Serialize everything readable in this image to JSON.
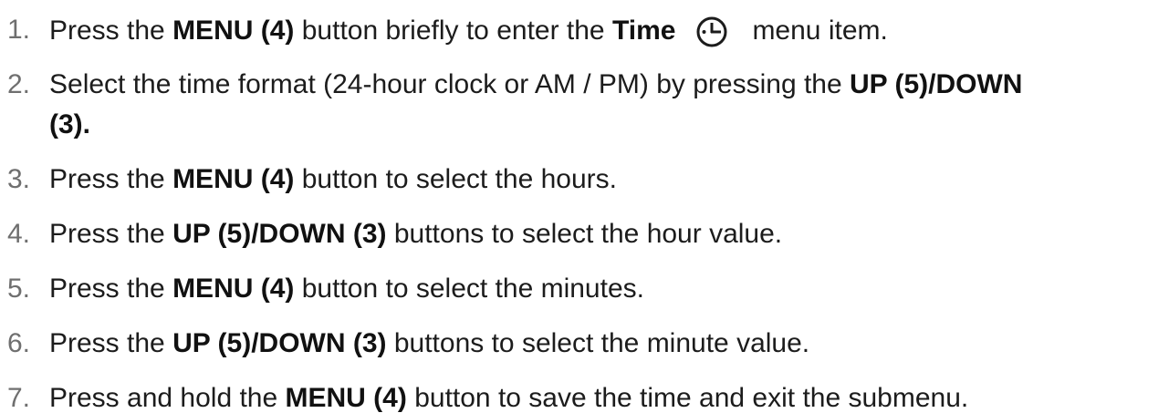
{
  "steps": [
    {
      "num": "1.",
      "parts": {
        "a": "Press the ",
        "b": "MENU (4)",
        "c": " button briefly to enter the ",
        "d": "Time",
        "e": "menu item."
      },
      "icon": "clock-icon"
    },
    {
      "num": "2.",
      "parts": {
        "a": "Select the time format (24-hour clock or AM / PM) by pressing the ",
        "b": "UP (5)/DOWN",
        "c": "(3)."
      }
    },
    {
      "num": "3.",
      "parts": {
        "a": "Press the ",
        "b": "MENU (4)",
        "c": " button to select the hours."
      }
    },
    {
      "num": "4.",
      "parts": {
        "a": "Press the ",
        "b": "UP (5)/DOWN (3)",
        "c": " buttons to select the hour value."
      }
    },
    {
      "num": "5.",
      "parts": {
        "a": "Press the ",
        "b": "MENU (4)",
        "c": " button to select the minutes."
      }
    },
    {
      "num": "6.",
      "parts": {
        "a": "Press the ",
        "b": "UP (5)/DOWN (3)",
        "c": " buttons to select the minute value."
      }
    },
    {
      "num": "7.",
      "parts": {
        "a": "Press and hold the ",
        "b": "MENU (4)",
        "c": " button to save the time and exit the submenu."
      }
    }
  ]
}
